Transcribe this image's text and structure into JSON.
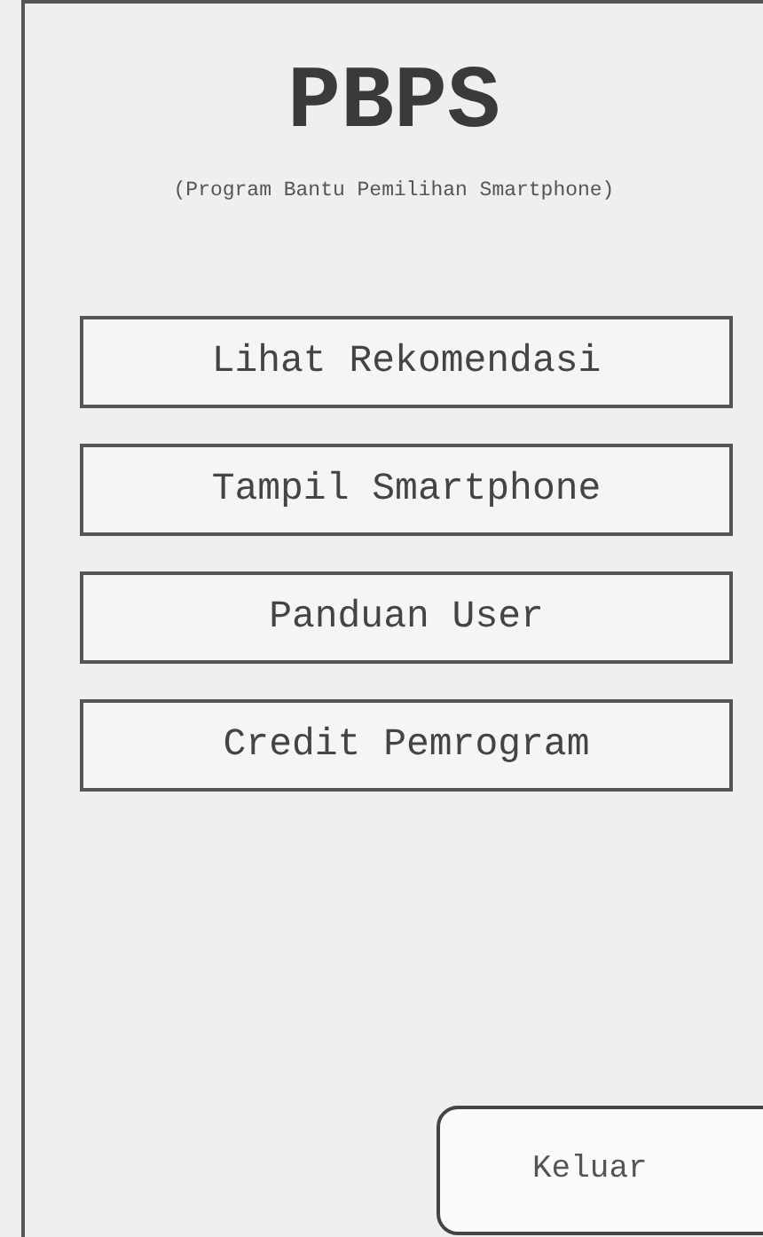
{
  "app": {
    "title": "PBPS",
    "subtitle": "(Program Bantu Pemilihan Smartphone)"
  },
  "menu_buttons": [
    {
      "label": "Lihat Rekomendasi"
    },
    {
      "label": "Tampil Smartphone"
    },
    {
      "label": "Panduan User"
    },
    {
      "label": "Credit Pemrogram"
    }
  ],
  "exit_button": {
    "label": "Keluar"
  }
}
